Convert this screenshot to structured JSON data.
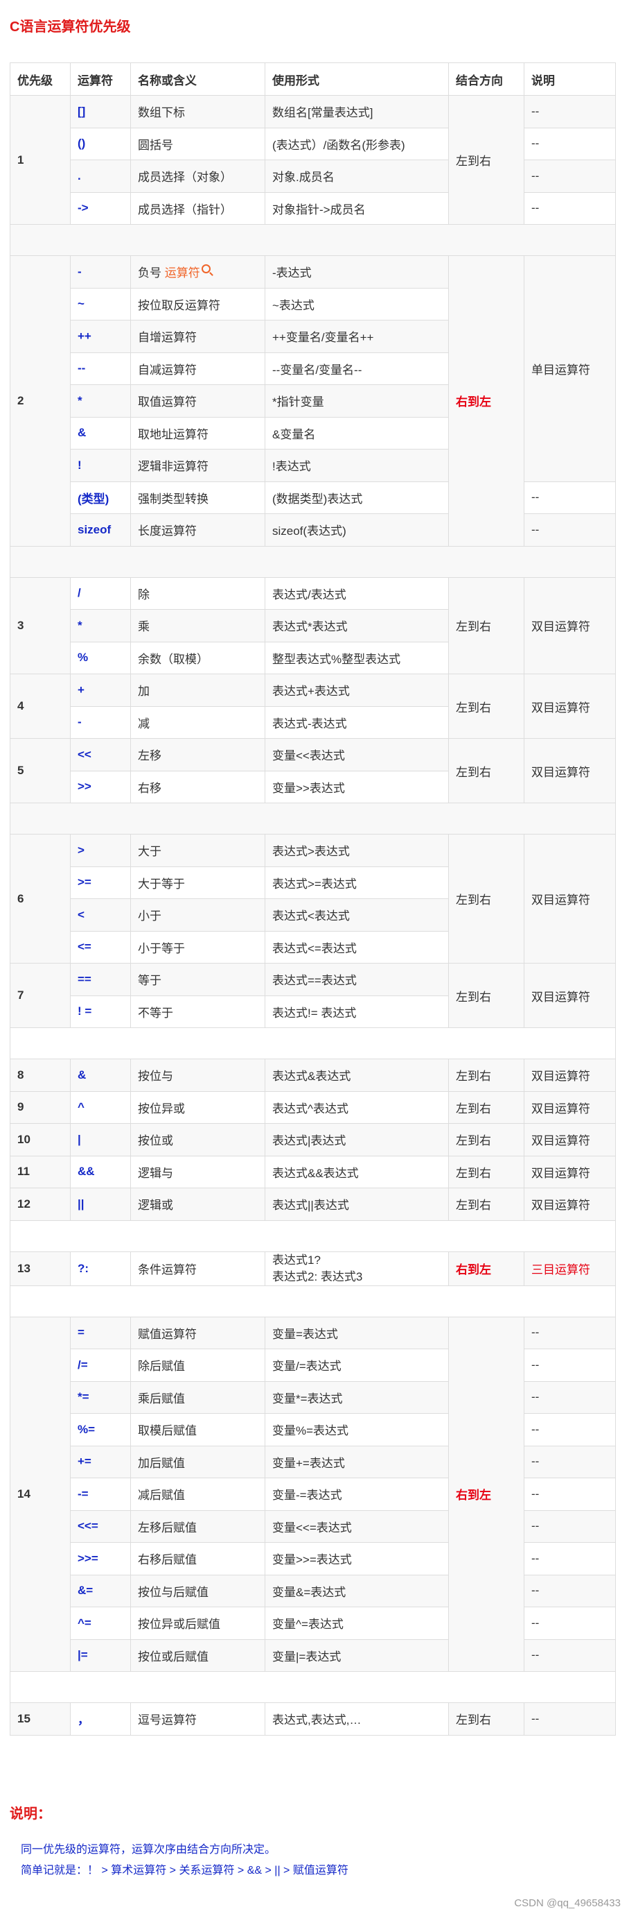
{
  "title": "C语言运算符优先级",
  "headers": [
    "优先级",
    "运算符",
    "名称或含义",
    "使用形式",
    "结合方向",
    "说明"
  ],
  "groups": [
    {
      "prio": "1",
      "assoc": "左到右",
      "assoc_red": false,
      "rows": [
        {
          "op": "[]",
          "name": "数组下标",
          "form": "数组名[常量表达式]",
          "note": "--"
        },
        {
          "op": "()",
          "name": "圆括号",
          "form": "(表达式）/函数名(形参表)",
          "note": "--"
        },
        {
          "op": ".",
          "name": "成员选择（对象）",
          "form": "对象.成员名",
          "note": "--"
        },
        {
          "op": "->",
          "name": "成员选择（指针）",
          "form": "对象指针->成员名",
          "note": "--"
        }
      ]
    },
    {
      "prio": "2",
      "assoc": "右到左",
      "assoc_red": true,
      "merged_note": "单目运算符",
      "rows": [
        {
          "op": "-",
          "name": "负号",
          "name_link": "运算符",
          "form": "-表达式"
        },
        {
          "op": "~",
          "name": "按位取反运算符",
          "form": "~表达式"
        },
        {
          "op": "++",
          "name": "自增运算符",
          "form": "++变量名/变量名++"
        },
        {
          "op": "--",
          "name": "自减运算符",
          "form": "--变量名/变量名--"
        },
        {
          "op": "*",
          "name": "取值运算符",
          "form": "*指针变量"
        },
        {
          "op": "&",
          "name": "取地址运算符",
          "form": "&变量名"
        },
        {
          "op": "!",
          "name": "逻辑非运算符",
          "form": "!表达式"
        },
        {
          "op": "(类型)",
          "name": "强制类型转换",
          "form": "(数据类型)表达式",
          "note": "--"
        },
        {
          "op": "sizeof",
          "name": "长度运算符",
          "form": "sizeof(表达式)",
          "note": "--"
        }
      ]
    },
    {
      "prio": "3",
      "assoc": "左到右",
      "note": "双目运算符",
      "rows": [
        {
          "op": "/",
          "name": "除",
          "form": "表达式/表达式"
        },
        {
          "op": "*",
          "name": "乘",
          "form": "表达式*表达式"
        },
        {
          "op": "%",
          "name": "余数（取模）",
          "form": "整型表达式%整型表达式"
        }
      ]
    },
    {
      "prio": "4",
      "assoc": "左到右",
      "note": "双目运算符",
      "rows": [
        {
          "op": "+",
          "name": "加",
          "form": "表达式+表达式"
        },
        {
          "op": "-",
          "name": "减",
          "form": "表达式-表达式"
        }
      ]
    },
    {
      "prio": "5",
      "assoc": "左到右",
      "note": "双目运算符",
      "rows": [
        {
          "op": "<<",
          "name": "左移",
          "form": "变量<<表达式"
        },
        {
          "op": ">>",
          "name": "右移",
          "form": "变量>>表达式"
        }
      ]
    },
    {
      "prio": "6",
      "assoc": "左到右",
      "note": "双目运算符",
      "rows": [
        {
          "op": ">",
          "name": "大于",
          "form": "表达式>表达式"
        },
        {
          "op": ">=",
          "name": "大于等于",
          "form": "表达式>=表达式"
        },
        {
          "op": "<",
          "name": "小于",
          "form": "表达式<表达式"
        },
        {
          "op": "<=",
          "name": "小于等于",
          "form": "表达式<=表达式"
        }
      ]
    },
    {
      "prio": "7",
      "assoc": "左到右",
      "note": "双目运算符",
      "rows": [
        {
          "op": "==",
          "name": "等于",
          "form": "表达式==表达式"
        },
        {
          "op": "! =",
          "name": "不等于",
          "form": "表达式!= 表达式"
        }
      ]
    },
    {
      "prio": "8",
      "assoc": "左到右",
      "note": "双目运算符",
      "rows": [
        {
          "op": "&",
          "name": "按位与",
          "form": "表达式&表达式"
        }
      ]
    },
    {
      "prio": "9",
      "assoc": "左到右",
      "note": "双目运算符",
      "rows": [
        {
          "op": "^",
          "name": "按位异或",
          "form": "表达式^表达式"
        }
      ]
    },
    {
      "prio": "10",
      "assoc": "左到右",
      "note": "双目运算符",
      "rows": [
        {
          "op": "|",
          "name": "按位或",
          "form": "表达式|表达式"
        }
      ]
    },
    {
      "prio": "11",
      "assoc": "左到右",
      "note": "双目运算符",
      "rows": [
        {
          "op": "&&",
          "name": "逻辑与",
          "form": "表达式&&表达式"
        }
      ]
    },
    {
      "prio": "12",
      "assoc": "左到右",
      "note": "双目运算符",
      "rows": [
        {
          "op": "||",
          "name": "逻辑或",
          "form": "表达式||表达式"
        }
      ]
    },
    {
      "prio": "13",
      "assoc": "右到左",
      "assoc_red": true,
      "note": "三目运算符",
      "note_red": true,
      "rows": [
        {
          "op": "?:",
          "name": "条件运算符",
          "form_lines": [
            "表达式1?",
            "表达式2: 表达式3"
          ]
        }
      ]
    },
    {
      "prio": "14",
      "assoc": "右到左",
      "assoc_red": true,
      "rows": [
        {
          "op": "=",
          "name": "赋值运算符",
          "form": "变量=表达式",
          "note": "--"
        },
        {
          "op": "/=",
          "name": "除后赋值",
          "form": "变量/=表达式",
          "note": "--"
        },
        {
          "op": "*=",
          "name": "乘后赋值",
          "form": "变量*=表达式",
          "note": "--"
        },
        {
          "op": "%=",
          "name": "取模后赋值",
          "form": "变量%=表达式",
          "note": "--"
        },
        {
          "op": "+=",
          "name": "加后赋值",
          "form": "变量+=表达式",
          "note": "--"
        },
        {
          "op": "-=",
          "name": "减后赋值",
          "form": "变量-=表达式",
          "note": "--"
        },
        {
          "op": "<<=",
          "name": "左移后赋值",
          "form": "变量<<=表达式",
          "note": "--"
        },
        {
          "op": ">>=",
          "name": "右移后赋值",
          "form": "变量>>=表达式",
          "note": "--"
        },
        {
          "op": "&=",
          "name": "按位与后赋值",
          "form": "变量&=表达式",
          "note": "--"
        },
        {
          "op": "^=",
          "name": "按位异或后赋值",
          "form": "变量^=表达式",
          "note": "--"
        },
        {
          "op": "|=",
          "name": "按位或后赋值",
          "form": "变量|=表达式",
          "note": "--"
        }
      ]
    },
    {
      "prio": "15",
      "assoc": "左到右",
      "note": "--",
      "rows": [
        {
          "op": "，",
          "name": "逗号运算符",
          "form": "表达式,表达式,…"
        }
      ]
    }
  ],
  "notes_title": "说明：",
  "notes": [
    "同一优先级的运算符，运算次序由结合方向所决定。",
    "简单记就是：！ > 算术运算符 > 关系运算符 > && > || > 赋值运算符"
  ],
  "watermark": "CSDN @qq_49658433",
  "colors": {
    "title_red": "#e01b1b",
    "operator_blue": "#1428c8",
    "row_alt_bg": "#f8f8f8",
    "border": "#dddddd",
    "link_orange": "#f06428"
  }
}
